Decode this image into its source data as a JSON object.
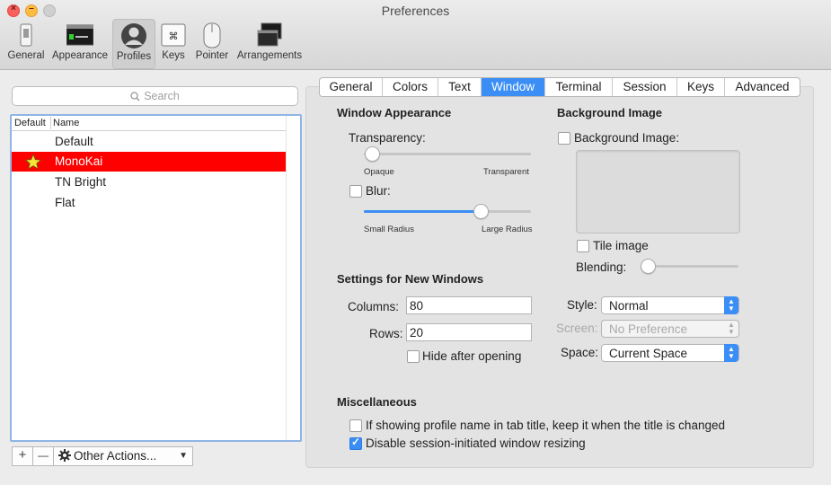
{
  "window": {
    "title": "Preferences"
  },
  "toolbar": {
    "items": [
      {
        "label": "General",
        "icon": "switch-icon"
      },
      {
        "label": "Appearance",
        "icon": "terminal-window-icon"
      },
      {
        "label": "Profiles",
        "icon": "user-silhouette-icon",
        "selected": true
      },
      {
        "label": "Keys",
        "icon": "keyboard-key-icon"
      },
      {
        "label": "Pointer",
        "icon": "mouse-icon"
      },
      {
        "label": "Arrangements",
        "icon": "stacked-windows-icon"
      }
    ]
  },
  "profiles": {
    "search_placeholder": "Search",
    "columns": {
      "default": "Default",
      "name": "Name"
    },
    "rows": [
      {
        "name": "Default",
        "is_default": false,
        "selected": false
      },
      {
        "name": "MonoKai",
        "is_default": true,
        "selected": true
      },
      {
        "name": "TN Bright",
        "is_default": false,
        "selected": false
      },
      {
        "name": "Flat",
        "is_default": false,
        "selected": false
      }
    ],
    "add_label": "+",
    "remove_label": "—",
    "other_actions_label": "Other Actions..."
  },
  "tabs": [
    {
      "label": "General"
    },
    {
      "label": "Colors"
    },
    {
      "label": "Text"
    },
    {
      "label": "Window",
      "selected": true
    },
    {
      "label": "Terminal"
    },
    {
      "label": "Session"
    },
    {
      "label": "Keys"
    },
    {
      "label": "Advanced"
    }
  ],
  "window_appearance": {
    "heading": "Window Appearance",
    "transparency_label": "Transparency:",
    "transparency_value": 0.0,
    "opaque_label": "Opaque",
    "transparent_label": "Transparent",
    "blur_label": "Blur:",
    "blur_checked": false,
    "blur_radius_value": 0.7,
    "small_radius_label": "Small Radius",
    "large_radius_label": "Large Radius"
  },
  "background_image": {
    "heading": "Background Image",
    "checkbox_label": "Background Image:",
    "checked": false,
    "tile_label": "Tile image",
    "tile_checked": false,
    "blending_label": "Blending:",
    "blending_value": 0.0
  },
  "new_windows": {
    "heading": "Settings for New Windows",
    "columns_label": "Columns:",
    "columns_value": "80",
    "rows_label": "Rows:",
    "rows_value": "20",
    "hide_label": "Hide after opening",
    "hide_checked": false,
    "style_label": "Style:",
    "style_value": "Normal",
    "screen_label": "Screen:",
    "screen_value": "No Preference",
    "space_label": "Space:",
    "space_value": "Current Space"
  },
  "misc": {
    "heading": "Miscellaneous",
    "keep_name_label": "If showing profile name in tab title, keep it when the title is changed",
    "keep_name_checked": false,
    "disable_resize_label": "Disable session-initiated window resizing",
    "disable_resize_checked": true
  },
  "colors": {
    "accent": "#3a8ef6",
    "selected_row": "#fe0000"
  }
}
